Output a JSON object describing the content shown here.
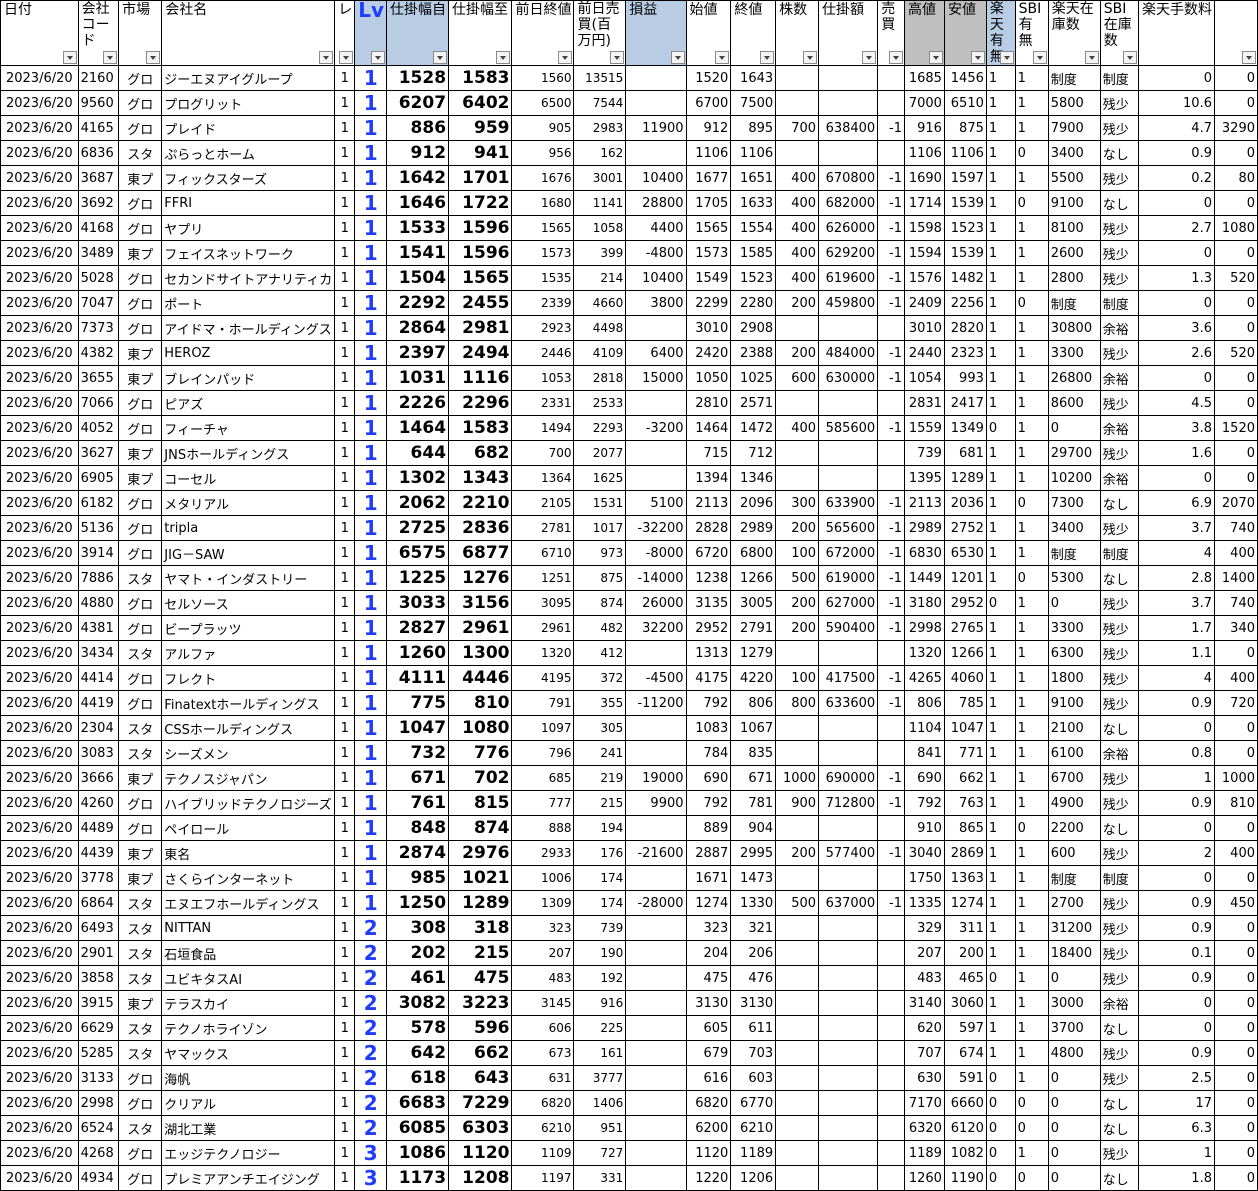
{
  "headers": [
    {
      "key": "date",
      "label": "日付"
    },
    {
      "key": "code",
      "label": "会社コード"
    },
    {
      "key": "market",
      "label": "市場"
    },
    {
      "key": "name",
      "label": "会社名"
    },
    {
      "key": "re",
      "label": "レ"
    },
    {
      "key": "lv",
      "label": "Lv"
    },
    {
      "key": "from",
      "label": "仕掛幅自"
    },
    {
      "key": "to",
      "label": "仕掛幅至"
    },
    {
      "key": "prev_close",
      "label": "前日終値"
    },
    {
      "key": "prev_volume",
      "label": "前日売買(百万円)"
    },
    {
      "key": "pnl",
      "label": "損益"
    },
    {
      "key": "open",
      "label": "始値"
    },
    {
      "key": "close",
      "label": "終値"
    },
    {
      "key": "shares",
      "label": "株数"
    },
    {
      "key": "amount",
      "label": "仕掛額"
    },
    {
      "key": "side",
      "label": "売買"
    },
    {
      "key": "high",
      "label": "高値"
    },
    {
      "key": "low",
      "label": "安値"
    },
    {
      "key": "rakuten_avail",
      "label": "楽天有無"
    },
    {
      "key": "sbi_avail",
      "label": "SBI有無"
    },
    {
      "key": "rakuten_stock",
      "label": "楽天在庫数"
    },
    {
      "key": "sbi_stock",
      "label": "SBI在庫数"
    },
    {
      "key": "fee_rate",
      "label": "楽天手数料"
    },
    {
      "key": "fee",
      "label": ""
    }
  ],
  "rows": [
    [
      "2023/6/20",
      "2160",
      "グロ",
      "ジーエヌアイグループ",
      "1",
      "1",
      "1528",
      "1583",
      "1560",
      "13515",
      "",
      "1520",
      "1643",
      "",
      "",
      "",
      "1685",
      "1456",
      "1",
      "1",
      "制度",
      "制度",
      "0",
      "0"
    ],
    [
      "2023/6/20",
      "9560",
      "グロ",
      "プログリット",
      "1",
      "1",
      "6207",
      "6402",
      "6500",
      "7544",
      "",
      "6700",
      "7500",
      "",
      "",
      "",
      "7000",
      "6510",
      "1",
      "1",
      "5800",
      "残少",
      "10.6",
      "0"
    ],
    [
      "2023/6/20",
      "4165",
      "グロ",
      "プレイド",
      "1",
      "1",
      "886",
      "959",
      "905",
      "2983",
      "11900",
      "912",
      "895",
      "700",
      "638400",
      "-1",
      "916",
      "875",
      "1",
      "1",
      "7900",
      "残少",
      "4.7",
      "3290"
    ],
    [
      "2023/6/20",
      "6836",
      "スタ",
      "ぷらっとホーム",
      "1",
      "1",
      "912",
      "941",
      "956",
      "162",
      "",
      "1106",
      "1106",
      "",
      "",
      "",
      "1106",
      "1106",
      "1",
      "0",
      "3400",
      "なし",
      "0.9",
      "0"
    ],
    [
      "2023/6/20",
      "3687",
      "東プ",
      "フィックスターズ",
      "1",
      "1",
      "1642",
      "1701",
      "1676",
      "3001",
      "10400",
      "1677",
      "1651",
      "400",
      "670800",
      "-1",
      "1690",
      "1597",
      "1",
      "1",
      "5500",
      "残少",
      "0.2",
      "80"
    ],
    [
      "2023/6/20",
      "3692",
      "グロ",
      "FFRI",
      "1",
      "1",
      "1646",
      "1722",
      "1680",
      "1141",
      "28800",
      "1705",
      "1633",
      "400",
      "682000",
      "-1",
      "1714",
      "1539",
      "1",
      "0",
      "9100",
      "なし",
      "0",
      "0"
    ],
    [
      "2023/6/20",
      "4168",
      "グロ",
      "ヤプリ",
      "1",
      "1",
      "1533",
      "1596",
      "1565",
      "1058",
      "4400",
      "1565",
      "1554",
      "400",
      "626000",
      "-1",
      "1598",
      "1523",
      "1",
      "1",
      "8100",
      "残少",
      "2.7",
      "1080"
    ],
    [
      "2023/6/20",
      "3489",
      "東プ",
      "フェイスネットワーク",
      "1",
      "1",
      "1541",
      "1596",
      "1573",
      "399",
      "-4800",
      "1573",
      "1585",
      "400",
      "629200",
      "-1",
      "1594",
      "1539",
      "1",
      "1",
      "2600",
      "残少",
      "0",
      "0"
    ],
    [
      "2023/6/20",
      "5028",
      "グロ",
      "セカンドサイトアナリティカ",
      "1",
      "1",
      "1504",
      "1565",
      "1535",
      "214",
      "10400",
      "1549",
      "1523",
      "400",
      "619600",
      "-1",
      "1576",
      "1482",
      "1",
      "1",
      "2800",
      "残少",
      "1.3",
      "520"
    ],
    [
      "2023/6/20",
      "7047",
      "グロ",
      "ポート",
      "1",
      "1",
      "2292",
      "2455",
      "2339",
      "4660",
      "3800",
      "2299",
      "2280",
      "200",
      "459800",
      "-1",
      "2409",
      "2256",
      "1",
      "0",
      "制度",
      "制度",
      "0",
      "0"
    ],
    [
      "2023/6/20",
      "7373",
      "グロ",
      "アイドマ・ホールディングス",
      "1",
      "1",
      "2864",
      "2981",
      "2923",
      "4498",
      "",
      "3010",
      "2908",
      "",
      "",
      "",
      "3010",
      "2820",
      "1",
      "1",
      "30800",
      "余裕",
      "3.6",
      "0"
    ],
    [
      "2023/6/20",
      "4382",
      "東プ",
      "HEROZ",
      "1",
      "1",
      "2397",
      "2494",
      "2446",
      "4109",
      "6400",
      "2420",
      "2388",
      "200",
      "484000",
      "-1",
      "2440",
      "2323",
      "1",
      "1",
      "3300",
      "残少",
      "2.6",
      "520"
    ],
    [
      "2023/6/20",
      "3655",
      "東プ",
      "ブレインパッド",
      "1",
      "1",
      "1031",
      "1116",
      "1053",
      "2818",
      "15000",
      "1050",
      "1025",
      "600",
      "630000",
      "-1",
      "1054",
      "993",
      "1",
      "1",
      "26800",
      "余裕",
      "0",
      "0"
    ],
    [
      "2023/6/20",
      "7066",
      "グロ",
      "ピアズ",
      "1",
      "1",
      "2226",
      "2296",
      "2331",
      "2533",
      "",
      "2810",
      "2571",
      "",
      "",
      "",
      "2831",
      "2417",
      "1",
      "1",
      "8600",
      "残少",
      "4.5",
      "0"
    ],
    [
      "2023/6/20",
      "4052",
      "グロ",
      "フィーチャ",
      "1",
      "1",
      "1464",
      "1583",
      "1494",
      "2293",
      "-3200",
      "1464",
      "1472",
      "400",
      "585600",
      "-1",
      "1559",
      "1349",
      "0",
      "1",
      "0",
      "余裕",
      "3.8",
      "1520"
    ],
    [
      "2023/6/20",
      "3627",
      "東プ",
      "JNSホールディングス",
      "1",
      "1",
      "644",
      "682",
      "700",
      "2077",
      "",
      "715",
      "712",
      "",
      "",
      "",
      "739",
      "681",
      "1",
      "1",
      "29700",
      "残少",
      "1.6",
      "0"
    ],
    [
      "2023/6/20",
      "6905",
      "東プ",
      "コーセル",
      "1",
      "1",
      "1302",
      "1343",
      "1364",
      "1625",
      "",
      "1394",
      "1346",
      "",
      "",
      "",
      "1395",
      "1289",
      "1",
      "1",
      "10200",
      "余裕",
      "0",
      "0"
    ],
    [
      "2023/6/20",
      "6182",
      "グロ",
      "メタリアル",
      "1",
      "1",
      "2062",
      "2210",
      "2105",
      "1531",
      "5100",
      "2113",
      "2096",
      "300",
      "633900",
      "-1",
      "2113",
      "2036",
      "1",
      "0",
      "7300",
      "なし",
      "6.9",
      "2070"
    ],
    [
      "2023/6/20",
      "5136",
      "グロ",
      "tripla",
      "1",
      "1",
      "2725",
      "2836",
      "2781",
      "1017",
      "-32200",
      "2828",
      "2989",
      "200",
      "565600",
      "-1",
      "2989",
      "2752",
      "1",
      "1",
      "3400",
      "残少",
      "3.7",
      "740"
    ],
    [
      "2023/6/20",
      "3914",
      "グロ",
      "JIG－SAW",
      "1",
      "1",
      "6575",
      "6877",
      "6710",
      "973",
      "-8000",
      "6720",
      "6800",
      "100",
      "672000",
      "-1",
      "6830",
      "6530",
      "1",
      "1",
      "制度",
      "制度",
      "4",
      "400"
    ],
    [
      "2023/6/20",
      "7886",
      "スタ",
      "ヤマト・インダストリー",
      "1",
      "1",
      "1225",
      "1276",
      "1251",
      "875",
      "-14000",
      "1238",
      "1266",
      "500",
      "619000",
      "-1",
      "1449",
      "1201",
      "1",
      "0",
      "5300",
      "なし",
      "2.8",
      "1400"
    ],
    [
      "2023/6/20",
      "4880",
      "グロ",
      "セルソース",
      "1",
      "1",
      "3033",
      "3156",
      "3095",
      "874",
      "26000",
      "3135",
      "3005",
      "200",
      "627000",
      "-1",
      "3180",
      "2952",
      "0",
      "1",
      "0",
      "残少",
      "3.7",
      "740"
    ],
    [
      "2023/6/20",
      "4381",
      "グロ",
      "ビープラッツ",
      "1",
      "1",
      "2827",
      "2961",
      "2961",
      "482",
      "32200",
      "2952",
      "2791",
      "200",
      "590400",
      "-1",
      "2998",
      "2765",
      "1",
      "1",
      "3300",
      "残少",
      "1.7",
      "340"
    ],
    [
      "2023/6/20",
      "3434",
      "スタ",
      "アルファ",
      "1",
      "1",
      "1260",
      "1300",
      "1320",
      "412",
      "",
      "1313",
      "1279",
      "",
      "",
      "",
      "1320",
      "1266",
      "1",
      "1",
      "6300",
      "残少",
      "1.1",
      "0"
    ],
    [
      "2023/6/20",
      "4414",
      "グロ",
      "フレクト",
      "1",
      "1",
      "4111",
      "4446",
      "4195",
      "372",
      "-4500",
      "4175",
      "4220",
      "100",
      "417500",
      "-1",
      "4265",
      "4060",
      "1",
      "1",
      "1800",
      "残少",
      "4",
      "400"
    ],
    [
      "2023/6/20",
      "4419",
      "グロ",
      "Finatextホールディングス",
      "1",
      "1",
      "775",
      "810",
      "791",
      "355",
      "-11200",
      "792",
      "806",
      "800",
      "633600",
      "-1",
      "806",
      "785",
      "1",
      "1",
      "9100",
      "残少",
      "0.9",
      "720"
    ],
    [
      "2023/6/20",
      "2304",
      "スタ",
      "CSSホールディングス",
      "1",
      "1",
      "1047",
      "1080",
      "1097",
      "305",
      "",
      "1083",
      "1067",
      "",
      "",
      "",
      "1104",
      "1047",
      "1",
      "1",
      "2100",
      "なし",
      "0",
      "0"
    ],
    [
      "2023/6/20",
      "3083",
      "スタ",
      "シーズメン",
      "1",
      "1",
      "732",
      "776",
      "796",
      "241",
      "",
      "784",
      "835",
      "",
      "",
      "",
      "841",
      "771",
      "1",
      "1",
      "6100",
      "余裕",
      "0.8",
      "0"
    ],
    [
      "2023/6/20",
      "3666",
      "東プ",
      "テクノスジャパン",
      "1",
      "1",
      "671",
      "702",
      "685",
      "219",
      "19000",
      "690",
      "671",
      "1000",
      "690000",
      "-1",
      "690",
      "662",
      "1",
      "1",
      "6700",
      "残少",
      "1",
      "1000"
    ],
    [
      "2023/6/20",
      "4260",
      "グロ",
      "ハイブリッドテクノロジーズ",
      "1",
      "1",
      "761",
      "815",
      "777",
      "215",
      "9900",
      "792",
      "781",
      "900",
      "712800",
      "-1",
      "792",
      "763",
      "1",
      "1",
      "4900",
      "残少",
      "0.9",
      "810"
    ],
    [
      "2023/6/20",
      "4489",
      "グロ",
      "ペイロール",
      "1",
      "1",
      "848",
      "874",
      "888",
      "194",
      "",
      "889",
      "904",
      "",
      "",
      "",
      "910",
      "865",
      "1",
      "0",
      "2200",
      "なし",
      "0",
      "0"
    ],
    [
      "2023/6/20",
      "4439",
      "東プ",
      "東名",
      "1",
      "1",
      "2874",
      "2976",
      "2933",
      "176",
      "-21600",
      "2887",
      "2995",
      "200",
      "577400",
      "-1",
      "3040",
      "2869",
      "1",
      "1",
      "600",
      "残少",
      "2",
      "400"
    ],
    [
      "2023/6/20",
      "3778",
      "東プ",
      "さくらインターネット",
      "1",
      "1",
      "985",
      "1021",
      "1006",
      "174",
      "",
      "1671",
      "1473",
      "",
      "",
      "",
      "1750",
      "1363",
      "1",
      "1",
      "制度",
      "制度",
      "0",
      "0"
    ],
    [
      "2023/6/20",
      "6864",
      "スタ",
      "エヌエフホールディングス",
      "1",
      "1",
      "1250",
      "1289",
      "1309",
      "174",
      "-28000",
      "1274",
      "1330",
      "500",
      "637000",
      "-1",
      "1335",
      "1274",
      "1",
      "1",
      "2700",
      "残少",
      "0.9",
      "450"
    ],
    [
      "2023/6/20",
      "6493",
      "スタ",
      "NITTAN",
      "1",
      "2",
      "308",
      "318",
      "323",
      "739",
      "",
      "323",
      "321",
      "",
      "",
      "",
      "329",
      "311",
      "1",
      "1",
      "31200",
      "残少",
      "0.9",
      "0"
    ],
    [
      "2023/6/20",
      "2901",
      "スタ",
      "石垣食品",
      "1",
      "2",
      "202",
      "215",
      "207",
      "190",
      "",
      "204",
      "206",
      "",
      "",
      "",
      "207",
      "200",
      "1",
      "1",
      "18400",
      "残少",
      "0.1",
      "0"
    ],
    [
      "2023/6/20",
      "3858",
      "スタ",
      "ユビキタスAI",
      "1",
      "2",
      "461",
      "475",
      "483",
      "192",
      "",
      "475",
      "476",
      "",
      "",
      "",
      "483",
      "465",
      "0",
      "1",
      "0",
      "残少",
      "0.9",
      "0"
    ],
    [
      "2023/6/20",
      "3915",
      "東プ",
      "テラスカイ",
      "1",
      "2",
      "3082",
      "3223",
      "3145",
      "916",
      "",
      "3130",
      "3130",
      "",
      "",
      "",
      "3140",
      "3060",
      "1",
      "1",
      "3000",
      "余裕",
      "0",
      "0"
    ],
    [
      "2023/6/20",
      "6629",
      "スタ",
      "テクノホライゾン",
      "1",
      "2",
      "578",
      "596",
      "606",
      "225",
      "",
      "605",
      "611",
      "",
      "",
      "",
      "620",
      "597",
      "1",
      "1",
      "3700",
      "なし",
      "0",
      "0"
    ],
    [
      "2023/6/20",
      "5285",
      "スタ",
      "ヤマックス",
      "1",
      "2",
      "642",
      "662",
      "673",
      "161",
      "",
      "679",
      "703",
      "",
      "",
      "",
      "707",
      "674",
      "1",
      "1",
      "4800",
      "残少",
      "0.9",
      "0"
    ],
    [
      "2023/6/20",
      "3133",
      "グロ",
      "海帆",
      "1",
      "2",
      "618",
      "643",
      "631",
      "3777",
      "",
      "616",
      "603",
      "",
      "",
      "",
      "630",
      "591",
      "0",
      "1",
      "0",
      "残少",
      "2.5",
      "0"
    ],
    [
      "2023/6/20",
      "2998",
      "グロ",
      "クリアル",
      "1",
      "2",
      "6683",
      "7229",
      "6820",
      "1406",
      "",
      "6820",
      "6770",
      "",
      "",
      "",
      "7170",
      "6660",
      "0",
      "0",
      "0",
      "なし",
      "17",
      "0"
    ],
    [
      "2023/6/20",
      "6524",
      "スタ",
      "湖北工業",
      "1",
      "2",
      "6085",
      "6303",
      "6210",
      "951",
      "",
      "6200",
      "6210",
      "",
      "",
      "",
      "6320",
      "6120",
      "0",
      "0",
      "0",
      "なし",
      "6.3",
      "0"
    ],
    [
      "2023/6/20",
      "4268",
      "グロ",
      "エッジテクノロジー",
      "1",
      "3",
      "1086",
      "1120",
      "1109",
      "727",
      "",
      "1120",
      "1189",
      "",
      "",
      "",
      "1189",
      "1082",
      "0",
      "1",
      "0",
      "残少",
      "1",
      "0"
    ],
    [
      "2023/6/20",
      "4934",
      "グロ",
      "プレミアアンチエイジング",
      "1",
      "3",
      "1173",
      "1208",
      "1197",
      "331",
      "",
      "1220",
      "1206",
      "",
      "",
      "",
      "1260",
      "1190",
      "0",
      "0",
      "0",
      "なし",
      "1.8",
      "0"
    ]
  ]
}
